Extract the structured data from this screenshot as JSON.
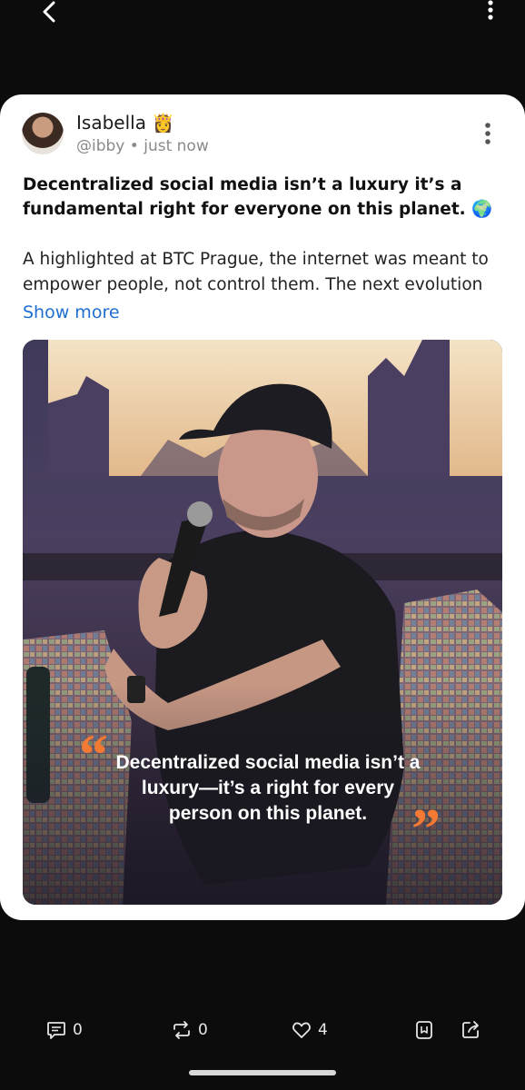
{
  "post": {
    "author_name": "Isabella",
    "author_emoji": "👸",
    "handle": "@ibby",
    "time": "just now",
    "headline": "Decentralized social media isn’t a luxury  it’s a fundamental right for everyone on this planet. 🌍",
    "body": "A highlighted at BTC Prague, the internet was meant to empower people, not control them. The next evolution",
    "show_more": "Show more",
    "image_quote": "Decentralized social media isn’t a luxury—it’s a right for every person on this planet."
  },
  "actions": {
    "comments": "0",
    "reposts": "0",
    "likes": "4"
  },
  "icons": {
    "back": "chevron-left-icon",
    "more": "vertical-ellipsis-icon",
    "comment": "comment-icon",
    "repost": "repost-icon",
    "like": "heart-icon",
    "bookmark": "bookmark-icon",
    "share": "share-icon"
  },
  "colors": {
    "link": "#1f6fd1",
    "quote_mark": "#f47a33",
    "background": "#0c0c0d"
  }
}
